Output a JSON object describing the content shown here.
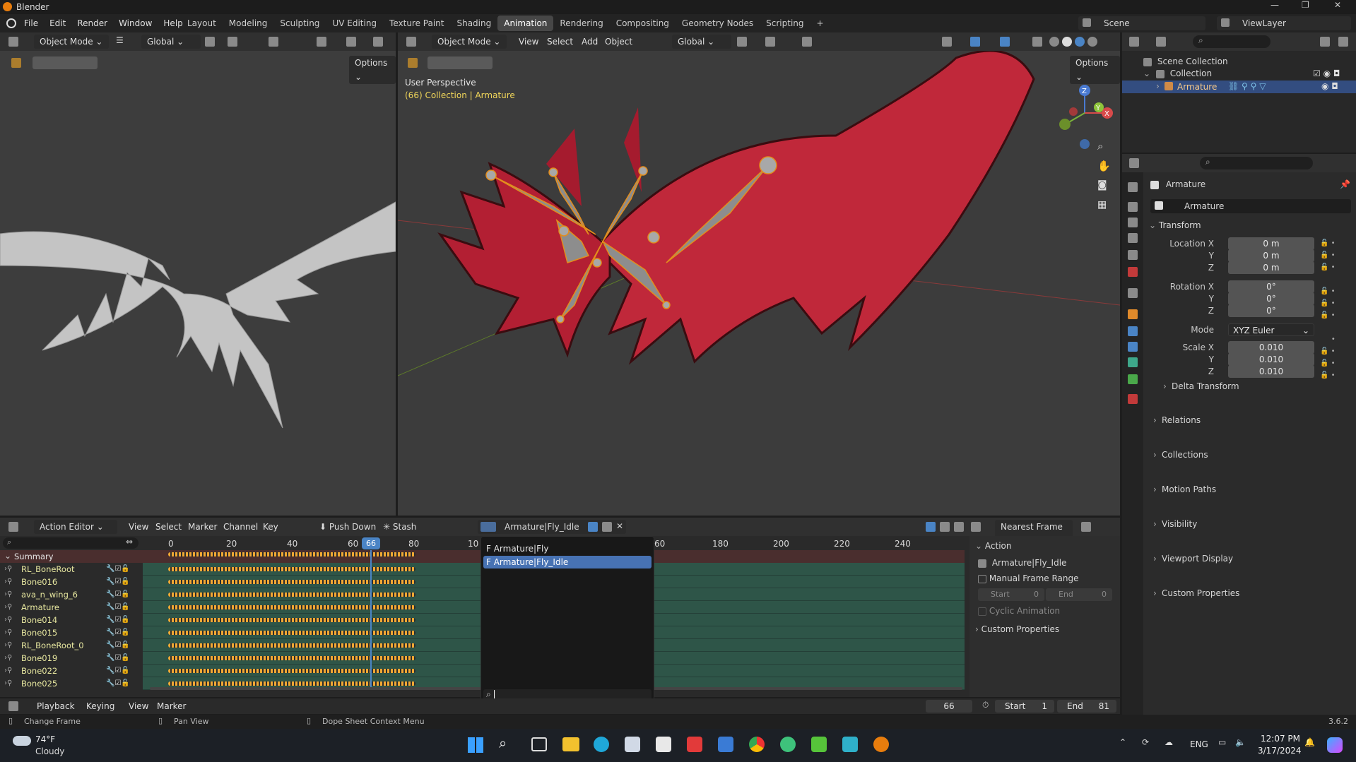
{
  "app": {
    "title": "Blender",
    "version": "3.6.2"
  },
  "menubar": {
    "items": [
      "File",
      "Edit",
      "Render",
      "Window",
      "Help"
    ]
  },
  "workspaces": {
    "tabs": [
      "Layout",
      "Modeling",
      "Sculpting",
      "UV Editing",
      "Texture Paint",
      "Shading",
      "Animation",
      "Rendering",
      "Compositing",
      "Geometry Nodes",
      "Scripting"
    ],
    "active": "Animation"
  },
  "scene": {
    "name": "Scene",
    "view_layer": "ViewLayer"
  },
  "left_viewport": {
    "mode": "Object Mode",
    "transform": "Global",
    "options": "Options"
  },
  "main_viewport": {
    "mode": "Object Mode",
    "menu": [
      "View",
      "Select",
      "Add",
      "Object"
    ],
    "transform": "Global",
    "options": "Options",
    "overlay_title": "User Perspective",
    "overlay_sub": "(66) Collection | Armature"
  },
  "outliner": {
    "items": [
      "Scene Collection",
      "Collection",
      "Armature"
    ]
  },
  "properties": {
    "object_name": "Armature",
    "data_name": "Armature",
    "transform_title": "Transform",
    "location": {
      "label": "Location X",
      "x": "0 m",
      "y": "0 m",
      "z": "0 m"
    },
    "rotation": {
      "label": "Rotation X",
      "x": "0°",
      "y": "0°",
      "z": "0°"
    },
    "mode_label": "Mode",
    "mode_value": "XYZ Euler",
    "scale": {
      "label": "Scale X",
      "x": "0.010",
      "y": "0.010",
      "z": "0.010"
    },
    "axis_y": "Y",
    "axis_z": "Z",
    "sections": [
      "Delta Transform",
      "Relations",
      "Collections",
      "Motion Paths",
      "Visibility",
      "Viewport Display",
      "Custom Properties"
    ]
  },
  "action_editor": {
    "editor": "Action Editor",
    "menu": [
      "View",
      "Select",
      "Marker",
      "Channel",
      "Key"
    ],
    "push_down": "Push Down",
    "stash": "Stash",
    "action_name": "Armature|Fly_Idle",
    "snap": "Nearest Frame",
    "ruler": [
      "0",
      "20",
      "40",
      "60",
      "80",
      "10",
      "60",
      "180",
      "200",
      "220",
      "240"
    ],
    "current_frame": "66",
    "channels": [
      "Summary",
      "RL_BoneRoot",
      "Bone016",
      "ava_n_wing_6",
      "Armature",
      "Bone014",
      "Bone015",
      "RL_BoneRoot_0",
      "Bone019",
      "Bone022",
      "Bone025"
    ]
  },
  "action_dropdown": {
    "items": [
      "F Armature|Fly",
      "F Armature|Fly_Idle"
    ],
    "selected": "F Armature|Fly_Idle"
  },
  "action_panel": {
    "title": "Action",
    "action": "Armature|Fly_Idle",
    "manual_range": "Manual Frame Range",
    "start_label": "Start",
    "start_value": "0",
    "end_label": "End",
    "end_value": "0",
    "cyclic": "Cyclic Animation",
    "custom_props": "Custom Properties"
  },
  "timeline": {
    "menu": [
      "Playback",
      "Keying",
      "View",
      "Marker"
    ],
    "frame": "66",
    "start_label": "Start",
    "start": "1",
    "end_label": "End",
    "end": "81"
  },
  "statusbar": {
    "change_frame": "Change Frame",
    "pan_view": "Pan View",
    "context_menu": "Dope Sheet Context Menu"
  },
  "taskbar": {
    "weather_temp": "74°F",
    "weather_desc": "Cloudy",
    "lang": "ENG",
    "time": "12:07 PM",
    "date": "3/17/2024"
  }
}
